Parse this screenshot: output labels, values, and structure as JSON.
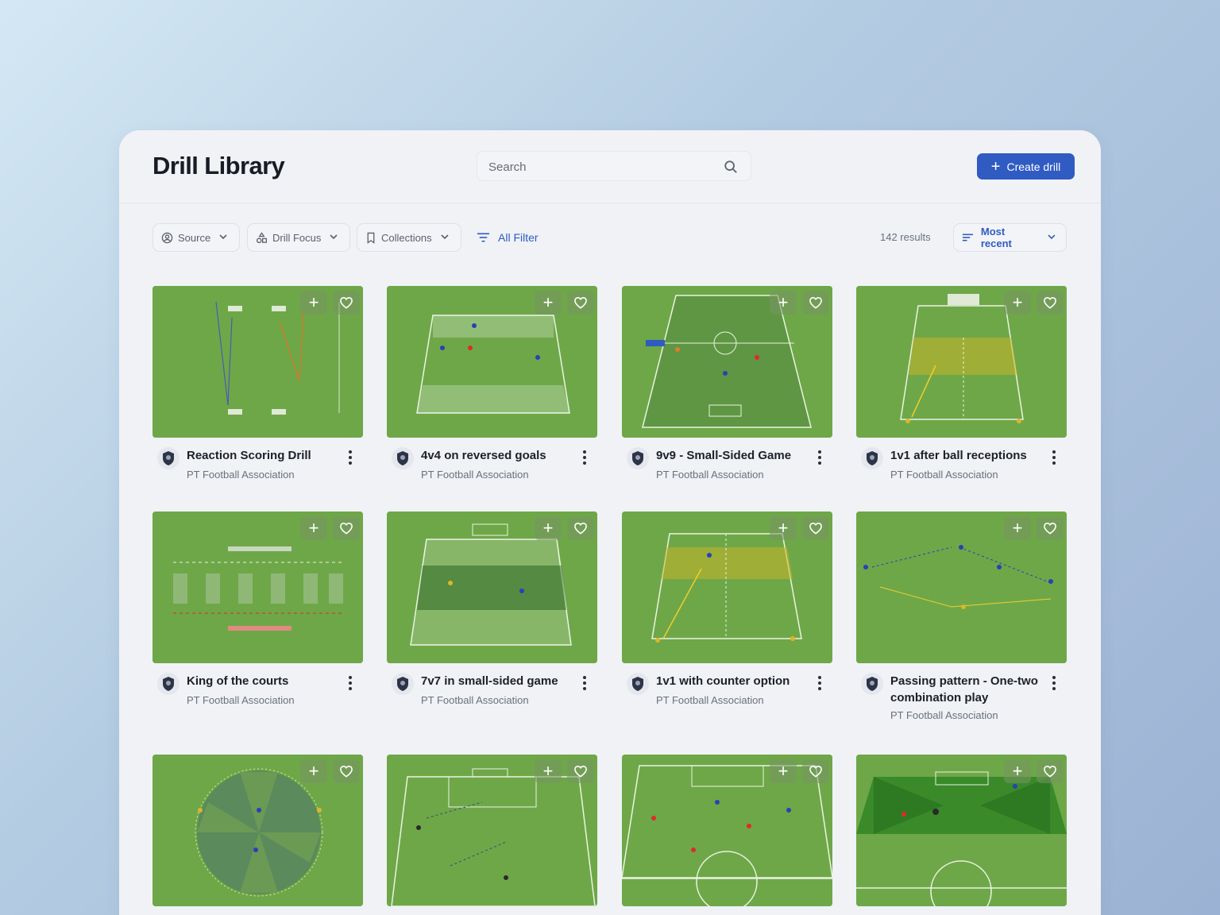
{
  "header": {
    "title": "Drill Library",
    "search_placeholder": "Search",
    "create_label": "Create drill"
  },
  "filters": {
    "source": "Source",
    "drill_focus": "Drill Focus",
    "collections": "Collections",
    "all_filter": "All Filter",
    "results": "142 results",
    "sort": "Most recent"
  },
  "colors": {
    "accent": "#2f5bc2",
    "pitch": "#6ea748"
  },
  "drills": [
    {
      "title": "Reaction Scoring Drill",
      "source": "PT Football Association"
    },
    {
      "title": "4v4 on reversed goals",
      "source": "PT Football Association"
    },
    {
      "title": "9v9 - Small-Sided Game",
      "source": "PT Football Association"
    },
    {
      "title": "1v1 after ball receptions",
      "source": "PT Football Association"
    },
    {
      "title": "King of the courts",
      "source": "PT Football Association"
    },
    {
      "title": "7v7 in small-sided game",
      "source": "PT Football Association"
    },
    {
      "title": "1v1 with counter option",
      "source": "PT Football Association"
    },
    {
      "title": "Passing pattern - One-two combination play",
      "source": "PT Football Association"
    },
    {
      "title": "",
      "source": ""
    },
    {
      "title": "",
      "source": ""
    },
    {
      "title": "",
      "source": ""
    },
    {
      "title": "",
      "source": ""
    }
  ]
}
